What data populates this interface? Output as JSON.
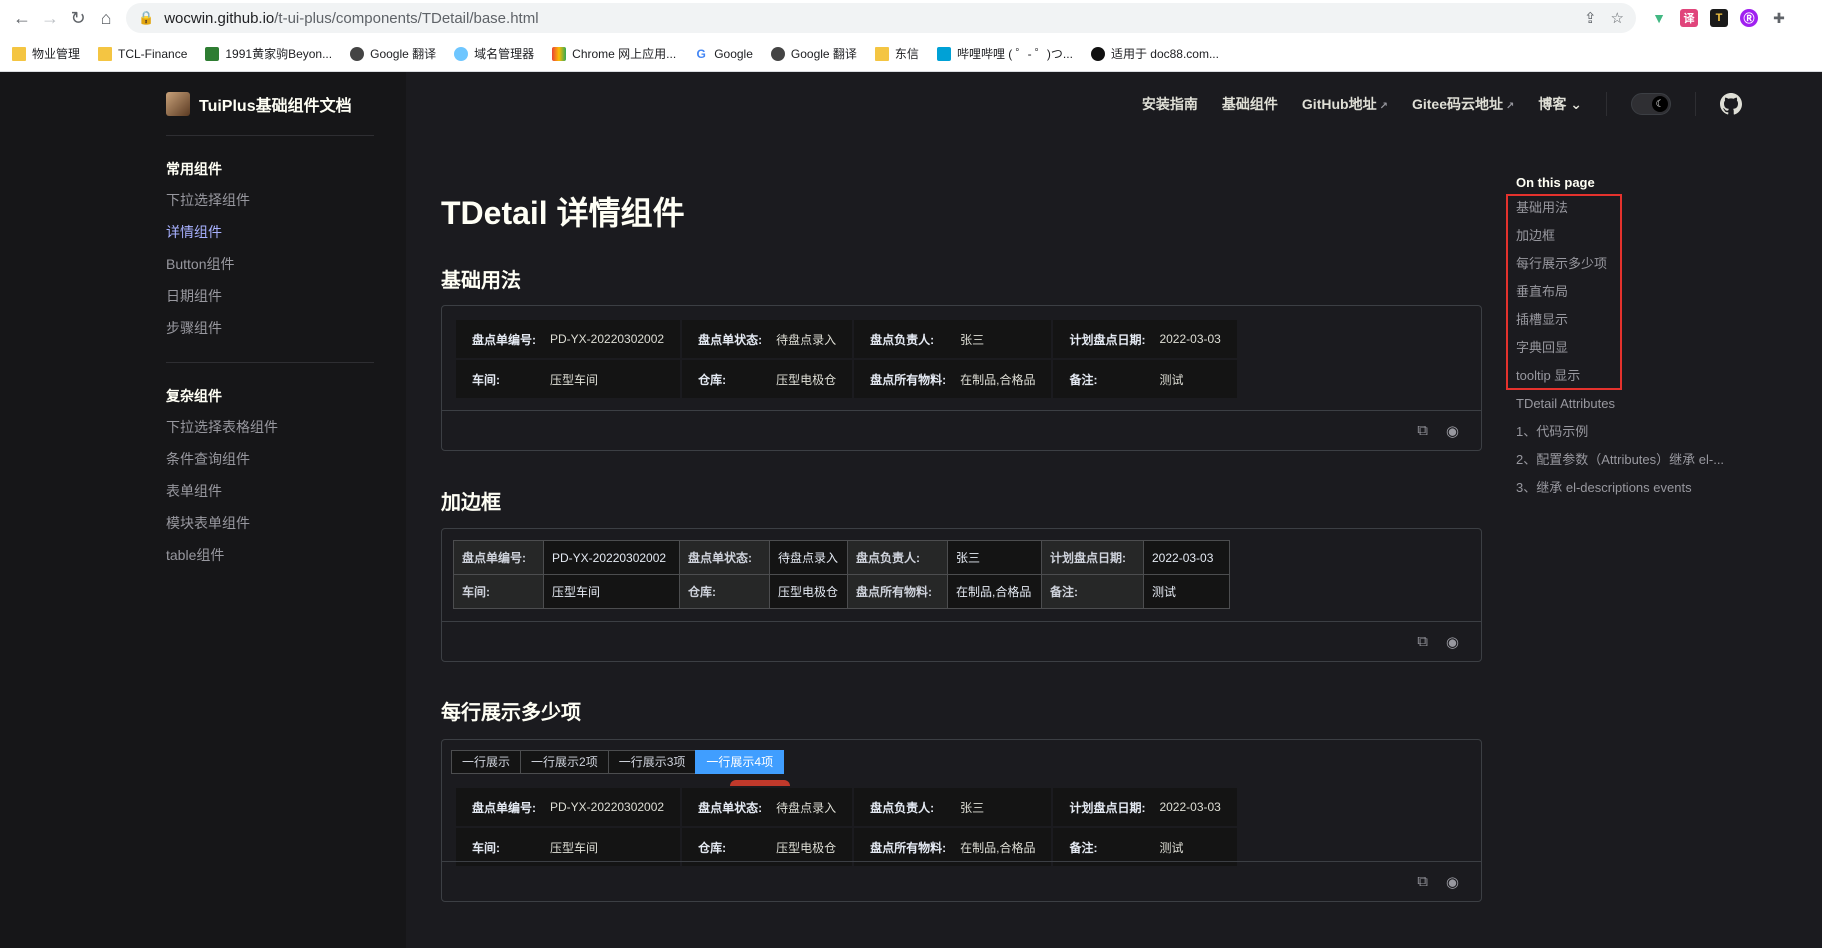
{
  "browser": {
    "url_host": "wocwin.github.io",
    "url_path": "/t-ui-plus/components/TDetail/base.html",
    "bookmarks": [
      "物业管理",
      "TCL-Finance",
      "1991黄家驹Beyon...",
      "Google 翻译",
      "域名管理器",
      "Chrome 网上应用...",
      "Google",
      "Google 翻译",
      "东信",
      "哔哩哔哩 ( ゜- ゜)つ...",
      "适用于 doc88.com..."
    ]
  },
  "site": {
    "title": "TuiPlus基础组件文档",
    "nav": [
      "安装指南",
      "基础组件",
      "GitHub地址",
      "Gitee码云地址",
      "博客"
    ],
    "nav_ext_arrow": "↗",
    "blog_caret": "⌄"
  },
  "sidebar": {
    "group1_title": "常用组件",
    "group1_items": [
      "下拉选择组件",
      "详情组件",
      "Button组件",
      "日期组件",
      "步骤组件"
    ],
    "group2_title": "复杂组件",
    "group2_items": [
      "下拉选择表格组件",
      "条件查询组件",
      "表单组件",
      "模块表单组件",
      "table组件"
    ]
  },
  "main": {
    "page_title": "TDetail 详情组件",
    "sec1": "基础用法",
    "sec2": "加边框",
    "sec3": "每行展示多少项",
    "fields": {
      "l1": "盘点单编号:",
      "v1": "PD-YX-20220302002",
      "l2": "盘点单状态:",
      "v2": "待盘点录入",
      "l3": "盘点负责人:",
      "v3": "张三",
      "l4": "计划盘点日期:",
      "v4": "2022-03-03",
      "l5": "车间:",
      "v5": "压型车间",
      "l6": "仓库:",
      "v6": "压型电极仓",
      "l7": "盘点所有物料:",
      "v7": "在制品,合格品",
      "l8": "备注:",
      "v8": "测试"
    },
    "segments": [
      "一行展示",
      "一行展示2项",
      "一行展示3项",
      "一行展示4项"
    ],
    "selected_segment": 3,
    "copy_icon": "⧉",
    "view_icon": "◉"
  },
  "toc": {
    "title": "On this page",
    "items": [
      "基础用法",
      "加边框",
      "每行展示多少项",
      "垂直布局",
      "插槽显示",
      "字典回显",
      "tooltip 显示",
      "TDetail Attributes",
      "1、代码示例",
      "2、配置参数（Attributes）继承 el-...",
      "3、继承 el-descriptions events"
    ]
  }
}
